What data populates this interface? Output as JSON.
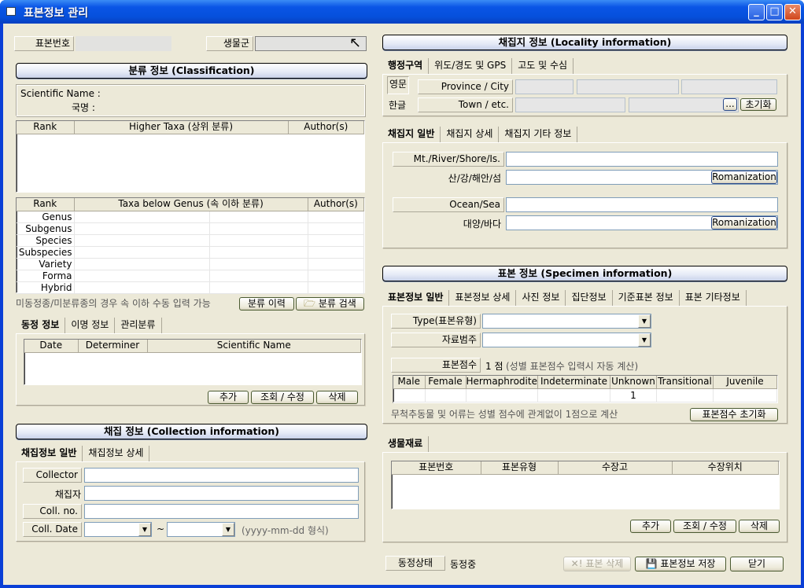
{
  "window": {
    "title": "표본정보 관리",
    "controls": {
      "minimize": "_",
      "maximize": "□",
      "close": "✕"
    }
  },
  "top": {
    "specimen_no_label": "표본번호",
    "specimen_no_value": "",
    "taxon_group_label": "생물군",
    "taxon_group_value": ""
  },
  "classification": {
    "header": "분류 정보 (Classification)",
    "scientific_name_label": "Scientific Name :",
    "korean_name_label": "국명 :",
    "higher_taxa": {
      "columns": [
        "Rank",
        "Higher Taxa (상위 분류)",
        "Author(s)"
      ],
      "rows": []
    },
    "below_genus": {
      "columns": [
        "Rank",
        "Taxa below Genus (속 이하 분류)",
        "Author(s)"
      ],
      "rows": [
        "Genus",
        "Subgenus",
        "Species",
        "Subspecies",
        "Variety",
        "Forma",
        "Hybrid"
      ]
    },
    "note": "미동정종/미분류종의 경우 속 이하 수동 입력 가능",
    "history_button": "분류 이력",
    "search_button": "분류 검색"
  },
  "identification": {
    "tabs": [
      "동정 정보",
      "이명 정보",
      "관리분류"
    ],
    "active_tab": 0,
    "columns": [
      "Date",
      "Determiner",
      "Scientific Name"
    ],
    "buttons": {
      "add": "추가",
      "view_edit": "조회 / 수정",
      "delete": "삭제"
    }
  },
  "collection": {
    "header": "채집 정보 (Collection information)",
    "tabs": [
      "채집정보 일반",
      "채집정보 상세"
    ],
    "active_tab": 0,
    "collector_label": "Collector",
    "collector_kr_label": "채집자",
    "coll_no_label": "Coll. no.",
    "coll_date_label": "Coll. Date",
    "date_sep": "~",
    "date_format_hint": "(yyyy-mm-dd 형식)"
  },
  "locality": {
    "header": "채집지 정보 (Locality information)",
    "admin_tabs": [
      "행정구역",
      "위도/경도 및 GPS",
      "고도 및 수심"
    ],
    "active_admin_tab": 0,
    "eng_label": "영문",
    "kor_label": "한글",
    "province_label": "Province / City",
    "town_label": "Town / etc.",
    "browse_button": "...",
    "reset_button": "초기화",
    "general_tabs": [
      "채집지 일반",
      "채집지 상세",
      "채집지 기타 정보"
    ],
    "active_general_tab": 0,
    "mt_label": "Mt./River/Shore/Is.",
    "mt_kr_label": "산/강/해안/섬",
    "ocean_label": "Ocean/Sea",
    "ocean_kr_label": "대양/바다",
    "romanization_button": "Romanization"
  },
  "specimen": {
    "header": "표본 정보 (Specimen information)",
    "tabs": [
      "표본정보 일반",
      "표본정보 상세",
      "사진 정보",
      "집단정보",
      "기준표본 정보",
      "표본 기타정보"
    ],
    "active_tab": 0,
    "type_label": "Type(표본유형)",
    "category_label": "자료범주",
    "count_label": "표본점수",
    "count_value": "1 점",
    "count_note": "(성별 표본점수 입력시 자동 계산)",
    "sex_columns": [
      "Male",
      "Female",
      "Hermaphrodite",
      "Indeterminate",
      "Unknown",
      "Transitional",
      "Juvenile"
    ],
    "sex_values": [
      "",
      "",
      "",
      "",
      "1",
      "",
      ""
    ],
    "invert_note": "무척추동물 및 어류는 성별 점수에 관계없이 1점으로 계산",
    "reset_count_button": "표본점수 초기화"
  },
  "biomaterial": {
    "tab": "생물재료",
    "columns": [
      "표본번호",
      "표본유형",
      "수장고",
      "수장위치"
    ],
    "buttons": {
      "add": "추가",
      "view_edit": "조회 / 수정",
      "delete": "삭제"
    }
  },
  "footer": {
    "status_label": "동정상태",
    "status_value": "동정중",
    "delete_button": "표본 삭제",
    "save_button": "표본정보 저장",
    "close_button": "닫기"
  }
}
